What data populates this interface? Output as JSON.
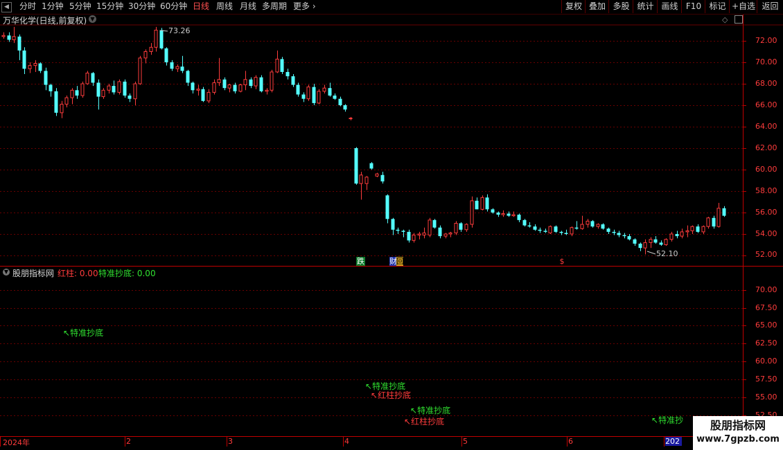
{
  "toolbar": {
    "periods": [
      "分时",
      "1分钟",
      "5分钟",
      "15分钟",
      "30分钟",
      "60分钟",
      "日线",
      "周线",
      "月线",
      "多周期",
      "更多"
    ],
    "active_period": "日线",
    "right_buttons": [
      "复权",
      "叠加",
      "多股",
      "统计",
      "画线",
      "F10",
      "标记",
      "+自选",
      "返回"
    ]
  },
  "stock": {
    "title": "万华化学(日线,前复权)",
    "high_label": "73.26",
    "low_label": "52.10"
  },
  "price_axis": [
    "72.00",
    "70.00",
    "68.00",
    "66.00",
    "64.00",
    "62.00",
    "60.00",
    "58.00",
    "56.00",
    "54.00",
    "52.00"
  ],
  "indicator": {
    "name": "股朋指标网",
    "red_label": "红柱: 0.00",
    "green_label": "特准抄底: 0.00",
    "axis": [
      "70.00",
      "67.50",
      "65.00",
      "62.50",
      "60.00",
      "57.50",
      "55.00",
      "52.50"
    ],
    "signals": [
      {
        "text": "特准抄底",
        "color": "green"
      },
      {
        "text": "特准抄底",
        "color": "green"
      },
      {
        "text": "红柱抄底",
        "color": "red"
      },
      {
        "text": "特准抄底",
        "color": "green"
      },
      {
        "text": "红柱抄底",
        "color": "red"
      },
      {
        "text": "特准抄",
        "color": "green"
      }
    ]
  },
  "events": [
    "跌",
    "财",
    "回",
    "$"
  ],
  "x_axis": [
    "2024年",
    "2",
    "3",
    "4",
    "5",
    "6",
    "202"
  ],
  "watermark": {
    "line1": "股朋指标网",
    "line2": "www.7gpzb.com"
  },
  "colors": {
    "up": "#ff3c3c",
    "down": "#54ffff",
    "grid": "#6a0000",
    "bg": "#000000"
  },
  "chart_data": {
    "type": "candlestick",
    "y_range": [
      51.5,
      73.5
    ],
    "ohlc": [
      [
        72.4,
        72.8,
        72.2,
        72.5
      ],
      [
        72.5,
        72.8,
        71.9,
        72.1
      ],
      [
        72.1,
        73.3,
        71.8,
        72.4
      ],
      [
        72.4,
        72.6,
        70.2,
        71.1
      ],
      [
        71.1,
        71.4,
        68.9,
        69.4
      ],
      [
        69.4,
        70.0,
        69.0,
        69.7
      ],
      [
        69.7,
        70.2,
        69.1,
        69.9
      ],
      [
        69.9,
        70.0,
        69.0,
        69.2
      ],
      [
        69.2,
        69.5,
        67.4,
        67.9
      ],
      [
        67.9,
        68.0,
        66.8,
        67.3
      ],
      [
        67.3,
        67.6,
        65.0,
        65.3
      ],
      [
        65.3,
        66.4,
        64.8,
        66.1
      ],
      [
        66.1,
        66.9,
        65.8,
        66.7
      ],
      [
        66.7,
        67.6,
        66.1,
        67.4
      ],
      [
        67.4,
        67.8,
        66.6,
        66.9
      ],
      [
        66.9,
        68.2,
        66.7,
        68.0
      ],
      [
        68.0,
        69.2,
        67.9,
        69.0
      ],
      [
        69.0,
        69.1,
        67.8,
        68.1
      ],
      [
        68.1,
        68.4,
        65.6,
        66.8
      ],
      [
        66.8,
        67.6,
        66.6,
        67.4
      ],
      [
        67.4,
        68.0,
        67.1,
        67.8
      ],
      [
        67.8,
        68.3,
        67.0,
        67.2
      ],
      [
        67.2,
        68.4,
        67.0,
        68.2
      ],
      [
        68.2,
        68.4,
        66.7,
        66.9
      ],
      [
        66.9,
        67.1,
        66.3,
        66.6
      ],
      [
        66.6,
        68.2,
        66.0,
        68.0
      ],
      [
        68.0,
        70.6,
        67.9,
        70.4
      ],
      [
        70.4,
        71.2,
        69.9,
        71.0
      ],
      [
        71.0,
        71.8,
        70.7,
        71.4
      ],
      [
        71.4,
        73.3,
        71.0,
        73.0
      ],
      [
        73.0,
        73.2,
        71.2,
        71.3
      ],
      [
        71.3,
        71.4,
        69.7,
        70.0
      ],
      [
        70.0,
        70.2,
        69.2,
        69.4
      ],
      [
        69.4,
        69.8,
        69.1,
        69.6
      ],
      [
        69.6,
        70.6,
        69.0,
        69.2
      ],
      [
        69.2,
        69.3,
        67.8,
        68.1
      ],
      [
        68.1,
        68.2,
        67.1,
        67.4
      ],
      [
        67.4,
        67.9,
        66.9,
        67.5
      ],
      [
        67.5,
        67.7,
        66.3,
        66.4
      ],
      [
        66.4,
        67.5,
        66.2,
        67.2
      ],
      [
        67.2,
        68.4,
        67.0,
        68.1
      ],
      [
        68.1,
        70.4,
        67.8,
        68.4
      ],
      [
        68.4,
        68.6,
        67.4,
        67.6
      ],
      [
        67.6,
        68.0,
        67.2,
        67.9
      ],
      [
        67.9,
        68.1,
        67.1,
        67.3
      ],
      [
        67.3,
        68.0,
        67.2,
        67.9
      ],
      [
        67.9,
        69.2,
        67.4,
        68.4
      ],
      [
        68.4,
        68.6,
        67.6,
        67.8
      ],
      [
        67.8,
        68.8,
        67.5,
        68.6
      ],
      [
        68.6,
        68.8,
        67.2,
        67.3
      ],
      [
        67.3,
        67.6,
        67.0,
        67.4
      ],
      [
        67.4,
        69.3,
        67.2,
        69.1
      ],
      [
        69.1,
        71.1,
        69.0,
        70.3
      ],
      [
        70.3,
        70.5,
        68.9,
        69.1
      ],
      [
        69.1,
        69.4,
        68.4,
        68.7
      ],
      [
        68.7,
        68.9,
        67.7,
        67.9
      ],
      [
        67.9,
        68.1,
        66.8,
        67.0
      ],
      [
        67.0,
        67.2,
        66.3,
        66.6
      ],
      [
        66.6,
        67.9,
        66.4,
        67.7
      ],
      [
        67.7,
        68.0,
        66.0,
        66.2
      ],
      [
        66.2,
        67.5,
        66.1,
        67.3
      ],
      [
        67.3,
        67.9,
        67.1,
        67.6
      ],
      [
        67.6,
        68.1,
        66.8,
        66.9
      ],
      [
        66.9,
        67.1,
        66.5,
        66.6
      ],
      [
        66.6,
        66.8,
        65.9,
        66.0
      ],
      [
        66.0,
        66.1,
        65.4,
        65.6
      ],
      [
        64.8,
        64.9,
        64.6,
        64.8
      ],
      [
        62.0,
        62.1,
        58.6,
        58.7
      ],
      [
        58.7,
        59.8,
        57.2,
        59.5
      ],
      [
        58.7,
        59.4,
        58.1,
        59.3
      ],
      [
        60.6,
        60.7,
        60.0,
        60.1
      ],
      [
        59.4,
        59.7,
        59.3,
        59.6
      ],
      [
        59.5,
        59.8,
        58.7,
        58.9
      ],
      [
        57.6,
        57.7,
        55.0,
        55.4
      ],
      [
        55.4,
        55.5,
        53.9,
        54.4
      ],
      [
        54.4,
        54.6,
        54.0,
        54.3
      ],
      [
        54.3,
        54.4,
        53.7,
        54.2
      ],
      [
        54.2,
        54.4,
        53.2,
        53.4
      ],
      [
        53.4,
        54.1,
        53.2,
        53.9
      ],
      [
        53.9,
        54.2,
        53.5,
        54.0
      ],
      [
        53.9,
        54.6,
        53.6,
        54.1
      ],
      [
        53.9,
        55.5,
        53.7,
        55.3
      ],
      [
        55.3,
        55.4,
        54.5,
        54.6
      ],
      [
        54.6,
        54.8,
        53.6,
        53.8
      ],
      [
        53.8,
        54.1,
        53.6,
        54.0
      ],
      [
        54.0,
        54.2,
        53.7,
        54.1
      ],
      [
        54.1,
        55.2,
        53.9,
        55.0
      ],
      [
        55.0,
        55.1,
        54.2,
        54.4
      ],
      [
        54.4,
        55.0,
        54.2,
        54.9
      ],
      [
        54.9,
        57.5,
        54.6,
        57.1
      ],
      [
        57.1,
        57.4,
        56.3,
        56.3
      ],
      [
        56.3,
        57.6,
        56.2,
        57.4
      ],
      [
        57.4,
        57.7,
        56.1,
        56.3
      ],
      [
        56.3,
        56.4,
        55.9,
        56.0
      ],
      [
        56.0,
        56.1,
        55.6,
        55.8
      ],
      [
        55.8,
        56.2,
        55.6,
        55.9
      ],
      [
        55.9,
        56.1,
        55.6,
        55.7
      ],
      [
        55.7,
        56.1,
        55.6,
        55.8
      ],
      [
        55.8,
        55.9,
        55.1,
        55.3
      ],
      [
        55.3,
        55.4,
        54.7,
        54.8
      ],
      [
        54.8,
        55.1,
        54.6,
        54.7
      ],
      [
        54.7,
        54.9,
        54.3,
        54.4
      ],
      [
        54.4,
        54.6,
        54.1,
        54.3
      ],
      [
        54.3,
        54.5,
        54.1,
        54.2
      ],
      [
        54.1,
        54.8,
        54.0,
        54.7
      ],
      [
        54.7,
        54.8,
        54.1,
        54.2
      ],
      [
        54.2,
        54.3,
        53.9,
        54.1
      ],
      [
        54.1,
        54.4,
        53.9,
        54.0
      ],
      [
        54.0,
        54.7,
        53.8,
        54.6
      ],
      [
        54.6,
        55.2,
        54.4,
        54.5
      ],
      [
        54.5,
        55.7,
        54.4,
        54.9
      ],
      [
        54.9,
        55.4,
        54.6,
        55.2
      ],
      [
        55.2,
        55.3,
        54.6,
        54.7
      ],
      [
        54.7,
        55.0,
        54.5,
        54.9
      ],
      [
        54.9,
        55.0,
        54.4,
        54.5
      ],
      [
        54.5,
        54.6,
        54.0,
        54.2
      ],
      [
        54.2,
        54.4,
        53.9,
        54.1
      ],
      [
        54.1,
        54.3,
        53.7,
        53.9
      ],
      [
        53.9,
        54.1,
        53.6,
        53.8
      ],
      [
        53.8,
        54.0,
        53.4,
        53.5
      ],
      [
        53.5,
        53.6,
        52.9,
        53.1
      ],
      [
        53.1,
        53.2,
        52.4,
        52.7
      ],
      [
        52.7,
        53.5,
        52.1,
        53.2
      ],
      [
        53.2,
        53.7,
        52.7,
        53.5
      ],
      [
        53.5,
        53.8,
        53.1,
        53.2
      ],
      [
        53.2,
        53.4,
        52.9,
        53.0
      ],
      [
        53.0,
        53.6,
        52.9,
        53.5
      ],
      [
        53.5,
        54.2,
        53.3,
        54.0
      ],
      [
        54.0,
        54.3,
        53.6,
        53.8
      ],
      [
        53.8,
        54.5,
        53.6,
        54.2
      ],
      [
        54.2,
        54.8,
        53.7,
        54.3
      ],
      [
        54.3,
        54.8,
        54.0,
        54.7
      ],
      [
        54.7,
        54.9,
        54.1,
        54.2
      ],
      [
        54.2,
        54.8,
        54.0,
        54.7
      ],
      [
        54.7,
        55.6,
        54.5,
        55.5
      ],
      [
        55.5,
        55.7,
        54.5,
        54.7
      ],
      [
        54.7,
        56.9,
        54.6,
        56.4
      ],
      [
        56.4,
        56.6,
        55.6,
        55.7
      ]
    ]
  }
}
